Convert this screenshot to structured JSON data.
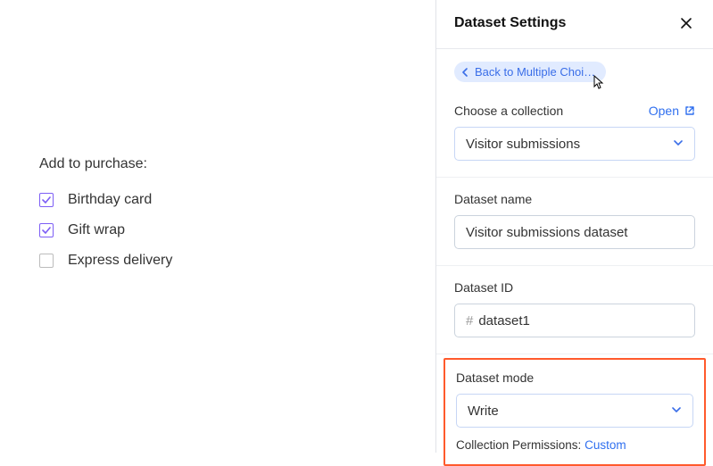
{
  "main": {
    "heading": "Add to purchase:",
    "options": [
      {
        "label": "Birthday card",
        "checked": true
      },
      {
        "label": "Gift wrap",
        "checked": true
      },
      {
        "label": "Express delivery",
        "checked": false
      }
    ]
  },
  "panel": {
    "title": "Dataset Settings",
    "back_label": "Back to Multiple Choi…",
    "collection": {
      "label": "Choose a collection",
      "open_label": "Open",
      "value": "Visitor submissions"
    },
    "dataset_name": {
      "label": "Dataset name",
      "value": "Visitor submissions dataset"
    },
    "dataset_id": {
      "label": "Dataset ID",
      "prefix": "#",
      "value": "dataset1"
    },
    "dataset_mode": {
      "label": "Dataset mode",
      "value": "Write"
    },
    "permissions": {
      "label": "Collection Permissions:",
      "value": "Custom"
    }
  },
  "colors": {
    "accent": "#2f6fef",
    "checkbox": "#7d5ef5",
    "highlight": "#ff5a2c"
  }
}
